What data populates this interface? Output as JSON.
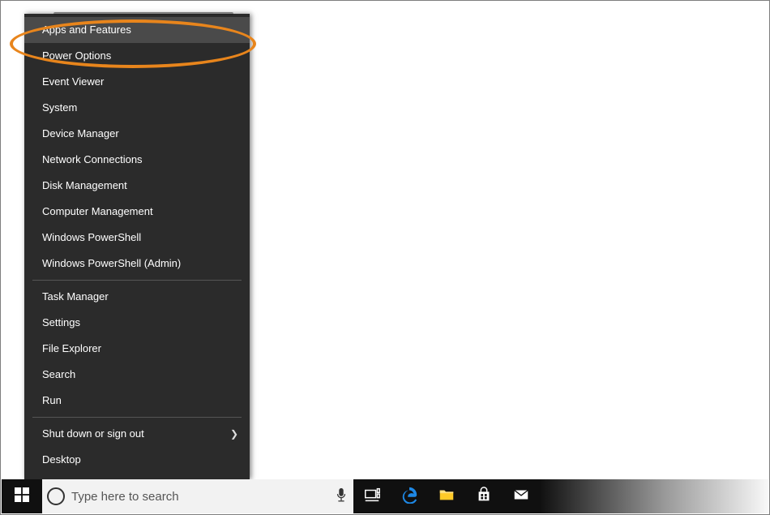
{
  "menu": {
    "group1": [
      "Apps and Features",
      "Power Options",
      "Event Viewer",
      "System",
      "Device Manager",
      "Network Connections",
      "Disk Management",
      "Computer Management",
      "Windows PowerShell",
      "Windows PowerShell (Admin)"
    ],
    "group2": [
      "Task Manager",
      "Settings",
      "File Explorer",
      "Search",
      "Run"
    ],
    "group3": [
      {
        "label": "Shut down or sign out",
        "submenu": true
      },
      {
        "label": "Desktop",
        "submenu": false
      }
    ]
  },
  "taskbar": {
    "search_placeholder": "Type here to search"
  }
}
